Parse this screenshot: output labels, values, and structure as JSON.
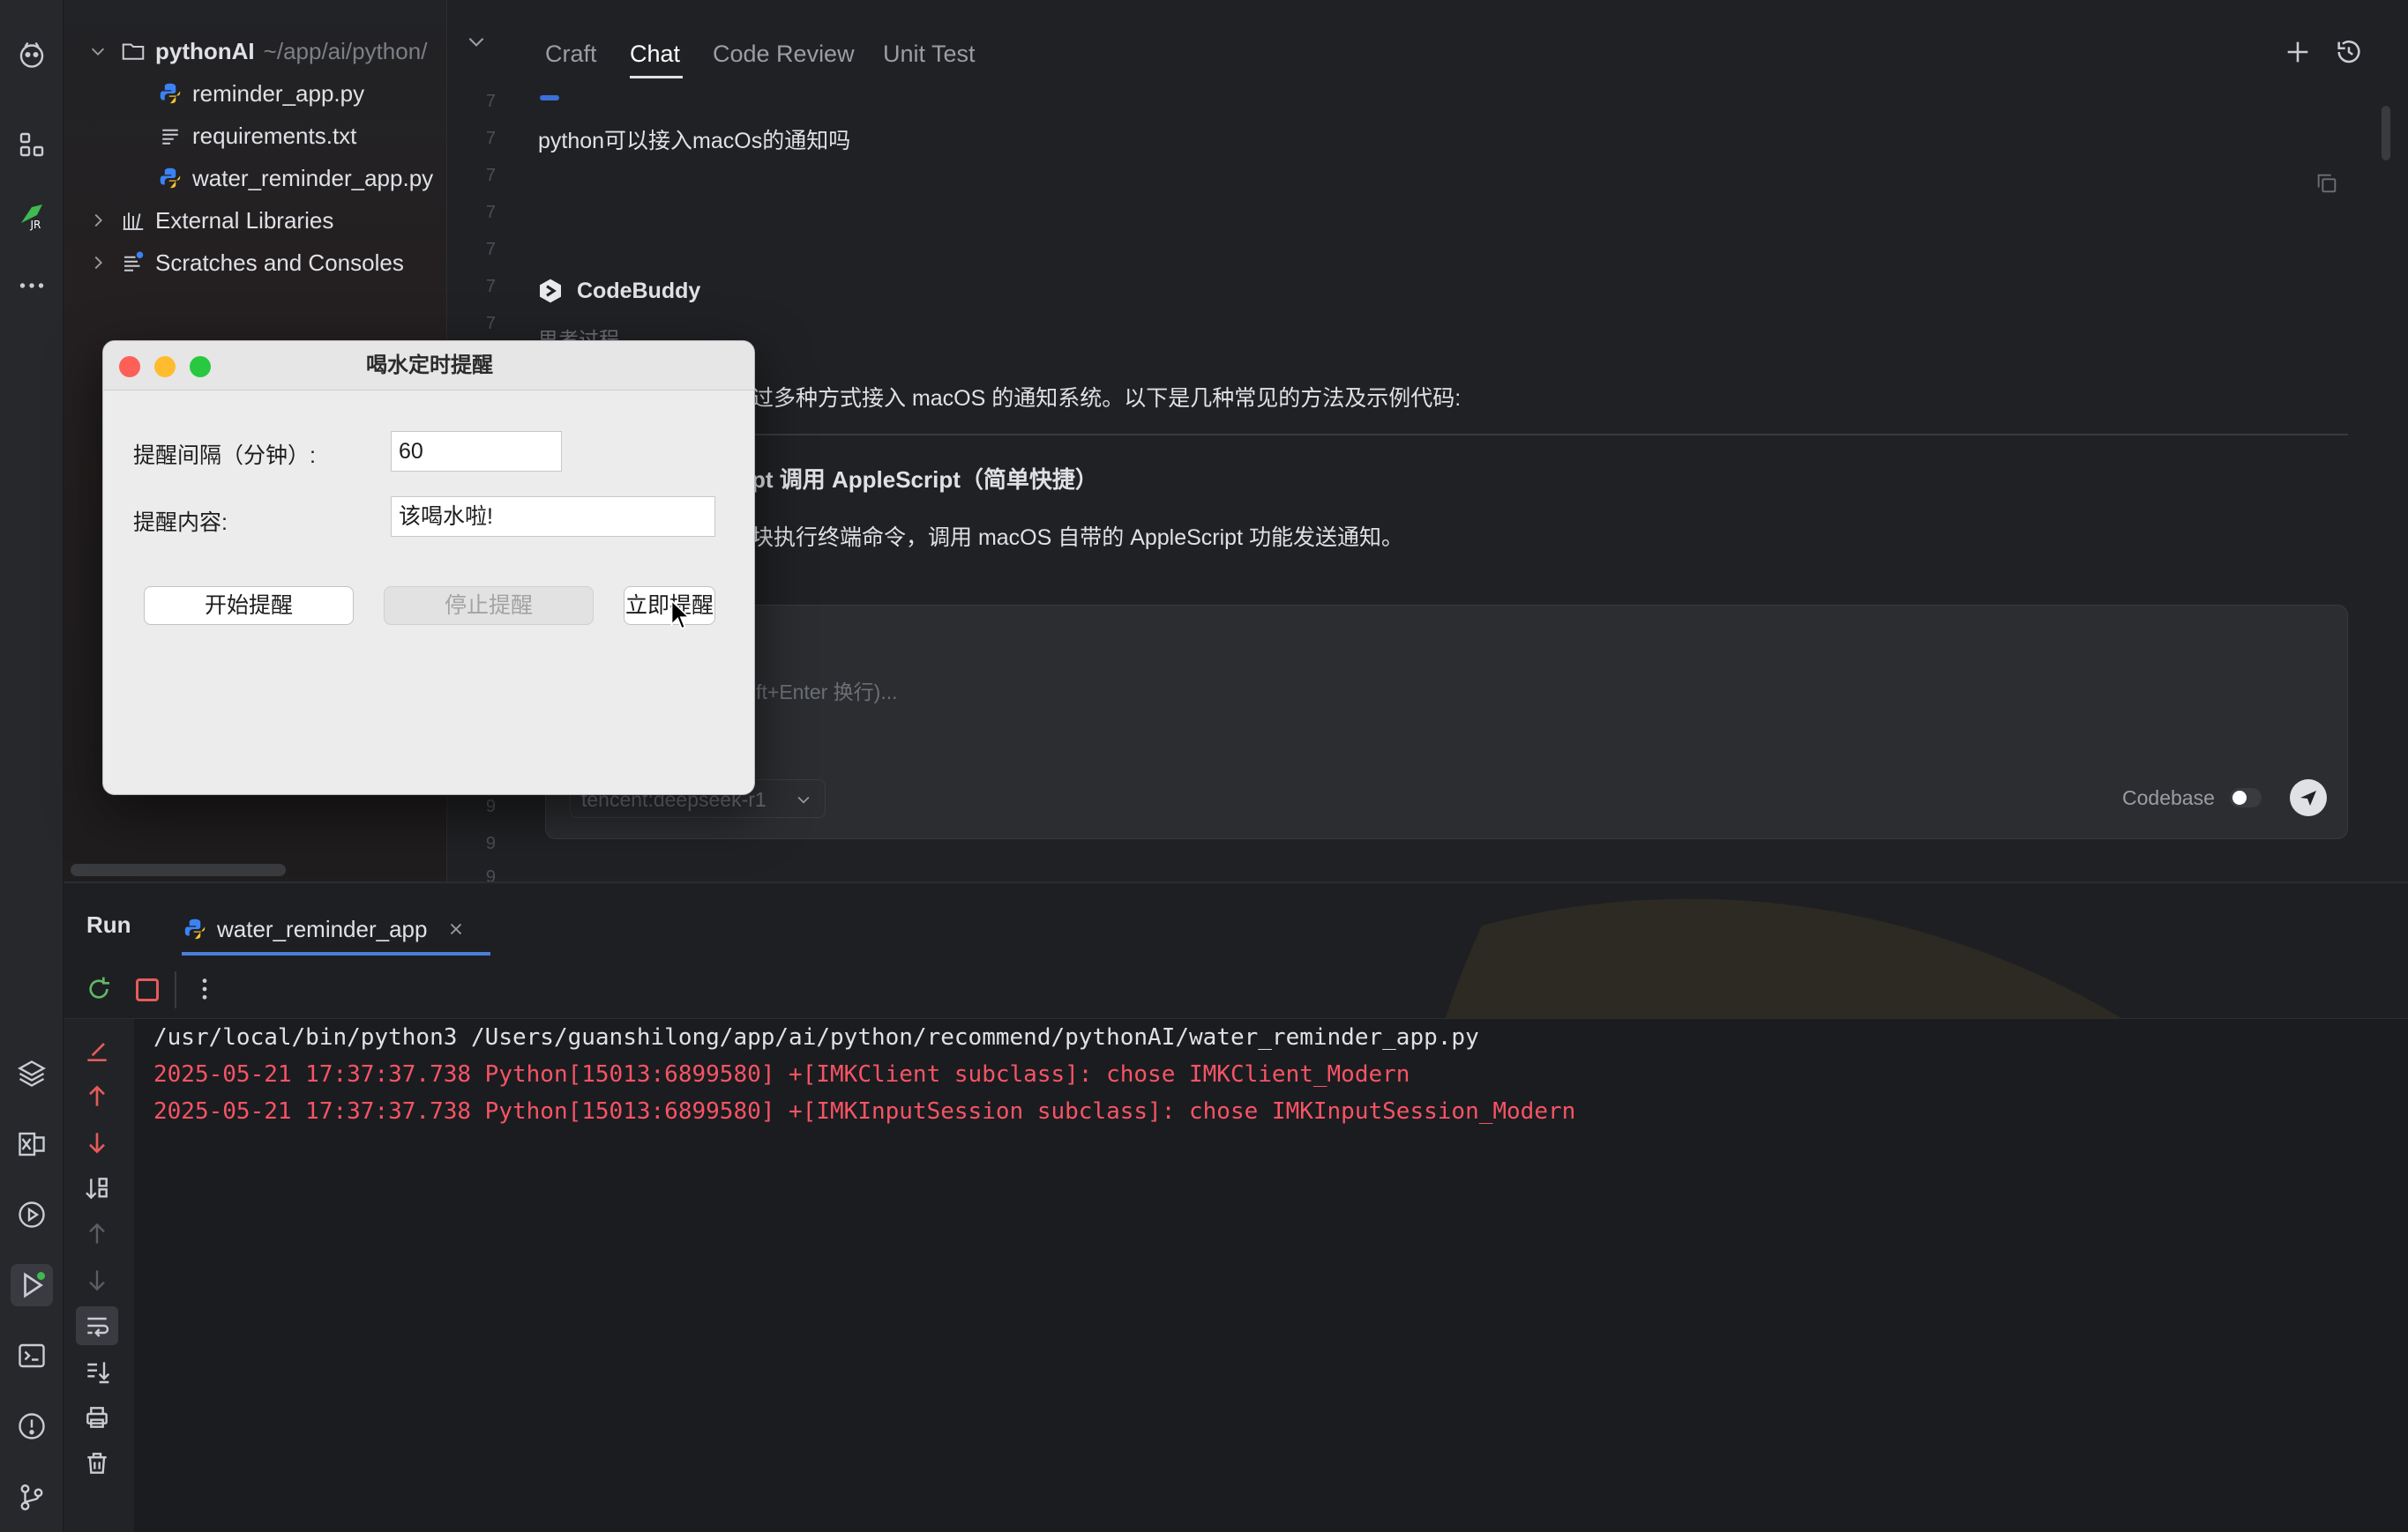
{
  "project": {
    "root_name": "pythonAI",
    "root_path": "~/app/ai/python/",
    "files": [
      "reminder_app.py",
      "requirements.txt",
      "water_reminder_app.py"
    ],
    "external_libraries": "External Libraries",
    "scratches": "Scratches and Consoles"
  },
  "chat": {
    "tabs": [
      "Craft",
      "Chat",
      "Code Review",
      "Unit Test"
    ],
    "active_tab": "Chat",
    "user_message": "python可以接入macOs的通知吗",
    "assistant_name": "CodeBuddy",
    "thinking_label": "思考过程",
    "answer_intro": "过多种方式接入 macOS 的通知系统。以下是几种常见的方法及示例代码:",
    "method_heading": "pt 调用 AppleScript（简单快捷）",
    "method_desc": "块执行终端命令，调用 macOS 自带的 AppleScript 功能发送通知。",
    "input_placeholder": "ift+Enter 换行)...",
    "model": "tencent:deepseek-r1",
    "codebase_label": "Codebase",
    "codebase_enabled": false
  },
  "gutter_numbers": [
    "7",
    "7",
    "7",
    "7",
    "7",
    "7",
    "7",
    "7",
    "9",
    "9",
    "9"
  ],
  "dialog": {
    "title": "喝水定时提醒",
    "interval_label": "提醒间隔（分钟）:",
    "interval_value": "60",
    "content_label": "提醒内容:",
    "content_value": "该喝水啦!",
    "start_button": "开始提醒",
    "stop_button": "停止提醒",
    "now_button": "立即提醒",
    "stop_enabled": false
  },
  "run": {
    "title": "Run",
    "tab_name": "water_reminder_app",
    "lines": [
      {
        "text": "/usr/local/bin/python3 /Users/guanshilong/app/ai/python/recommend/pythonAI/water_reminder_app.py",
        "kind": "cmd"
      },
      {
        "text": "2025-05-21 17:37:37.738 Python[15013:6899580] +[IMKClient subclass]: chose IMKClient_Modern",
        "kind": "err"
      },
      {
        "text": "2025-05-21 17:37:37.738 Python[15013:6899580] +[IMKInputSession subclass]: chose IMKInputSession_Modern",
        "kind": "err"
      }
    ]
  },
  "colors": {
    "stderr": "#f75464",
    "stdout": "#dfe1e5",
    "close_light": "#fe5f57",
    "minimize_light": "#febc2e",
    "zoom_light": "#28c840"
  }
}
